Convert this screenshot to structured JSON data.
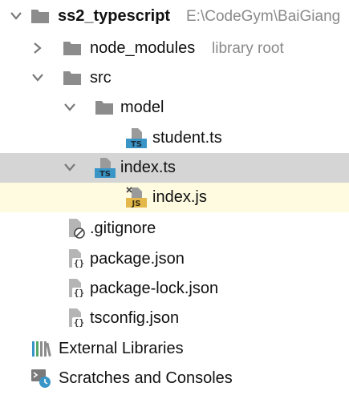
{
  "tree": {
    "project": {
      "name": "ss2_typescript",
      "path": "E:\\CodeGym\\BaiGiang",
      "icon": "folder-icon",
      "expanded": true
    },
    "node_modules": {
      "name": "node_modules",
      "hint": "library root",
      "icon": "folder-icon",
      "expanded": false
    },
    "src": {
      "name": "src",
      "icon": "folder-icon",
      "expanded": true
    },
    "model": {
      "name": "model",
      "icon": "folder-icon",
      "expanded": true
    },
    "student_ts": {
      "name": "student.ts",
      "icon": "typescript-file-icon",
      "badge": "TS"
    },
    "index_ts": {
      "name": "index.ts",
      "icon": "typescript-file-icon",
      "badge": "TS",
      "expanded": true,
      "selected": true
    },
    "index_js": {
      "name": "index.js",
      "icon": "javascript-file-icon",
      "badge": "JS",
      "opened_in_editor": true
    },
    "gitignore": {
      "name": ".gitignore",
      "icon": "ignored-file-icon"
    },
    "package_json": {
      "name": "package.json",
      "icon": "json-file-icon"
    },
    "package_lock_json": {
      "name": "package-lock.json",
      "icon": "json-file-icon"
    },
    "tsconfig_json": {
      "name": "tsconfig.json",
      "icon": "json-file-icon"
    },
    "external_libraries": {
      "name": "External Libraries",
      "icon": "libraries-icon"
    },
    "scratches": {
      "name": "Scratches and Consoles",
      "icon": "scratches-icon"
    }
  },
  "colors": {
    "folder": "#8c8c8c",
    "typescript_badge": "#3a95c7",
    "javascript_badge": "#e3b749",
    "selection": "#d5d5d5",
    "opened_row": "#fefbe0",
    "hint_text": "#8a8a8a"
  }
}
